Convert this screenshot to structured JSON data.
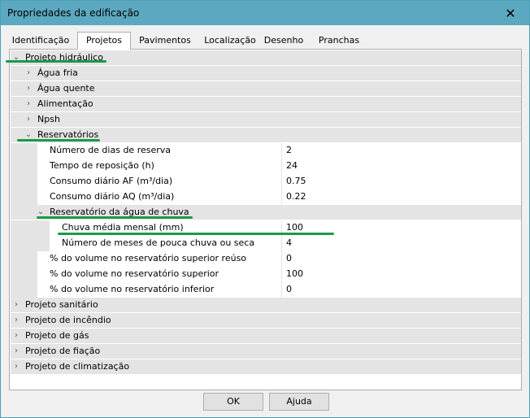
{
  "window": {
    "title": "Propriedades da edificação"
  },
  "tabs": [
    {
      "label": "Identificação"
    },
    {
      "label": "Projetos",
      "active": true
    },
    {
      "label": "Pavimentos"
    },
    {
      "label": "Localização"
    },
    {
      "label": "Desenho"
    },
    {
      "label": "Pranchas"
    }
  ],
  "tree": {
    "projeto_hidraulico": "Projeto hidráulico",
    "agua_fria": "Água fria",
    "agua_quente": "Água quente",
    "alimentacao": "Alimentação",
    "npsh": "Npsh",
    "reservatorios": "Reservatórios",
    "reservatorio_chuva": "Reservatório da água de chuva",
    "projeto_sanitario": "Projeto sanitário",
    "projeto_incendio": "Projeto de incêndio",
    "projeto_gas": "Projeto de gás",
    "projeto_fiacao": "Projeto de fiação",
    "projeto_climatizacao": "Projeto de climatização"
  },
  "properties": {
    "dias_reserva": {
      "label": "Número de dias de reserva",
      "value": "2"
    },
    "tempo_reposicao": {
      "label": "Tempo de reposição (h)",
      "value": "24"
    },
    "consumo_af": {
      "label": "Consumo diário AF (m³/dia)",
      "value": "0.75"
    },
    "consumo_aq": {
      "label": "Consumo diário AQ (m³/dia)",
      "value": "0.22"
    },
    "chuva_media": {
      "label": "Chuva média mensal (mm)",
      "value": "100"
    },
    "meses_pouca_chuva": {
      "label": "Número de meses de pouca chuva ou seca",
      "value": "4"
    },
    "vol_sup_reuso": {
      "label": "% do volume no reservatório superior reúso",
      "value": "0"
    },
    "vol_sup": {
      "label": "% do volume no reservatório superior",
      "value": "100"
    },
    "vol_inf": {
      "label": "% do volume no reservatório inferior",
      "value": "0"
    }
  },
  "buttons": {
    "ok": "OK",
    "ajuda": "Ajuda"
  },
  "colors": {
    "title_bar": "#5ba8c0",
    "annotation": "#1a9a4a",
    "category_bg": "#e4e4e4"
  }
}
